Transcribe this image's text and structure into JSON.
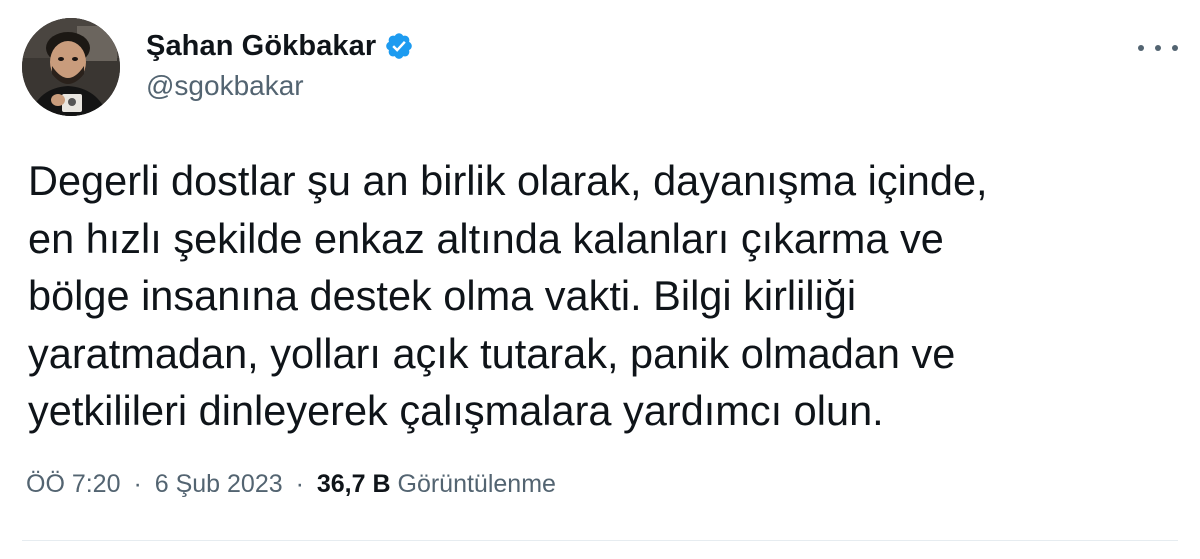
{
  "author": {
    "display_name": "Şahan Gökbakar",
    "handle": "@sgokbakar",
    "verified": true,
    "verified_color": "#1d9bf0"
  },
  "tweet": {
    "text_lines": [
      "Degerli dostlar şu an birlik olarak, dayanışma içinde,",
      "en hızlı şekilde enkaz altında kalanları çıkarma ve",
      "bölge insanına destek olma vakti. Bilgi kirliliği",
      "yaratmadan, yolları açık tutarak, panik olmadan ve",
      "yetkilileri dinleyerek çalışmalara yardımcı olun."
    ]
  },
  "meta": {
    "time": "ÖÖ 7:20",
    "separator": "·",
    "date": "6 Şub 2023",
    "views_count": "36,7 B",
    "views_label": "Görüntülenme"
  },
  "icons": {
    "more": "more-horizontal-icon",
    "verified": "verified-badge-icon"
  },
  "colors": {
    "text_primary": "#0f1419",
    "text_secondary": "#536471",
    "accent": "#1d9bf0"
  }
}
